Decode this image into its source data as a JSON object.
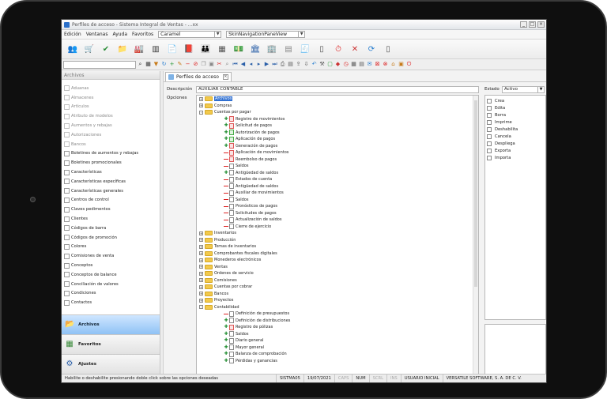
{
  "window": {
    "title": "Perfiles de acceso - Sistema Integral de Ventas - ...xx"
  },
  "menu": {
    "items": [
      "Edición",
      "Ventanas",
      "Ayuda",
      "Favoritos"
    ],
    "theme_combo": "Caramel",
    "view_combo": "SkinNavigationPaneView"
  },
  "toolbar1": {
    "icons": [
      "users-icon",
      "cart-icon",
      "check-icon",
      "folder-icon",
      "factory-icon",
      "barcode-icon",
      "document-icon",
      "book-icon",
      "people-icon",
      "calculator-icon",
      "money-icon",
      "bank-icon",
      "building-icon",
      "calendar-icon",
      "receipt-icon",
      "phone-icon",
      "clock-icon",
      "tools-icon",
      "sync-icon",
      "mobile-icon"
    ]
  },
  "sidebar": {
    "header": "Archivos",
    "items": [
      {
        "label": "Aduanas",
        "enabled": false
      },
      {
        "label": "Almacenes",
        "enabled": false
      },
      {
        "label": "Artículos",
        "enabled": false
      },
      {
        "label": "Atributo de modelos",
        "enabled": false
      },
      {
        "label": "Aumentos y rebajas",
        "enabled": false
      },
      {
        "label": "Autorizaciones",
        "enabled": false
      },
      {
        "label": "Bancos",
        "enabled": false
      },
      {
        "label": "Boletines de aumentos y rebajas",
        "enabled": true
      },
      {
        "label": "Boletines promocionales",
        "enabled": true
      },
      {
        "label": "Características",
        "enabled": true
      },
      {
        "label": "Características específicas",
        "enabled": true
      },
      {
        "label": "Características generales",
        "enabled": true
      },
      {
        "label": "Centros de control",
        "enabled": true
      },
      {
        "label": "Claves pedimentos",
        "enabled": true
      },
      {
        "label": "Clientes",
        "enabled": true
      },
      {
        "label": "Códigos de barra",
        "enabled": true
      },
      {
        "label": "Códigos de promoción",
        "enabled": true
      },
      {
        "label": "Colores",
        "enabled": true
      },
      {
        "label": "Comisiones de venta",
        "enabled": true
      },
      {
        "label": "Conceptos",
        "enabled": true
      },
      {
        "label": "Conceptos de balance",
        "enabled": true
      },
      {
        "label": "Conciliación de valores",
        "enabled": true
      },
      {
        "label": "Condiciones",
        "enabled": true
      },
      {
        "label": "Contactos",
        "enabled": true
      }
    ],
    "footer": [
      {
        "label": "Archivos",
        "icon": "folder-open-icon",
        "active": true
      },
      {
        "label": "Favoritos",
        "icon": "favorites-icon",
        "active": false
      },
      {
        "label": "Ajustes",
        "icon": "settings-icon",
        "active": false
      }
    ]
  },
  "tab": {
    "label": "Perfiles de acceso"
  },
  "form": {
    "descripcion_label": "Descripción",
    "descripcion_value": "AUXILIAR CONTABLE",
    "opciones_label": "Opciones",
    "estado_label": "Estado",
    "estado_value": "Activo"
  },
  "tree": [
    {
      "label": "Archivos",
      "level": 0,
      "type": "folder",
      "expander": "+",
      "selected": true
    },
    {
      "label": "Compras",
      "level": 0,
      "type": "folder",
      "expander": "+"
    },
    {
      "label": "Cuentas por pagar",
      "level": 0,
      "type": "folder",
      "expander": "-"
    },
    {
      "label": "Registro de movimientos",
      "level": 1,
      "type": "doc-red",
      "mark": "plus"
    },
    {
      "label": "Solicitud de pagos",
      "level": 1,
      "type": "doc-red",
      "mark": "plus"
    },
    {
      "label": "Autorización de pagos",
      "level": 1,
      "type": "doc-green",
      "mark": "plus"
    },
    {
      "label": "Aplicación de pagos",
      "level": 1,
      "type": "doc-green",
      "mark": "plus"
    },
    {
      "label": "Generación de pagos",
      "level": 1,
      "type": "doc-red",
      "mark": "plus"
    },
    {
      "label": "Aplicación de movimientos",
      "level": 1,
      "type": "doc-red",
      "mark": "dash"
    },
    {
      "label": "Reembolso de pagos",
      "level": 1,
      "type": "doc-red",
      "mark": "dash"
    },
    {
      "label": "Saldos",
      "level": 1,
      "type": "doc",
      "mark": "dash"
    },
    {
      "label": "Antigüedad de saldos",
      "level": 1,
      "type": "doc",
      "mark": "plus"
    },
    {
      "label": "Estados de cuenta",
      "level": 1,
      "type": "doc",
      "mark": "dash"
    },
    {
      "label": "Antigüedad de saldos",
      "level": 1,
      "type": "doc",
      "mark": "dash"
    },
    {
      "label": "Auxiliar de movimientos",
      "level": 1,
      "type": "doc",
      "mark": "dash"
    },
    {
      "label": "Saldos",
      "level": 1,
      "type": "doc",
      "mark": "dash"
    },
    {
      "label": "Pronósticos de pagos",
      "level": 1,
      "type": "doc",
      "mark": "dash"
    },
    {
      "label": "Solicitudes de pagos",
      "level": 1,
      "type": "doc",
      "mark": "dash"
    },
    {
      "label": "Actualización de saldos",
      "level": 1,
      "type": "doc",
      "mark": "dash"
    },
    {
      "label": "Cierre de ejercicio",
      "level": 1,
      "type": "doc",
      "mark": "dash"
    },
    {
      "label": "Inventarios",
      "level": 0,
      "type": "folder",
      "expander": "+"
    },
    {
      "label": "Producción",
      "level": 0,
      "type": "folder",
      "expander": "+"
    },
    {
      "label": "Tomas de inventarios",
      "level": 0,
      "type": "folder",
      "expander": "+"
    },
    {
      "label": "Comprobantes fiscales digitales",
      "level": 0,
      "type": "folder",
      "expander": "+"
    },
    {
      "label": "Monederos electrónicos",
      "level": 0,
      "type": "folder",
      "expander": "+"
    },
    {
      "label": "Ventas",
      "level": 0,
      "type": "folder",
      "expander": "+"
    },
    {
      "label": "Ordenes de servicio",
      "level": 0,
      "type": "folder",
      "expander": "+"
    },
    {
      "label": "Comisiones",
      "level": 0,
      "type": "folder",
      "expander": "+"
    },
    {
      "label": "Cuentas por cobrar",
      "level": 0,
      "type": "folder",
      "expander": "+"
    },
    {
      "label": "Bancos",
      "level": 0,
      "type": "folder",
      "expander": "+"
    },
    {
      "label": "Proyectos",
      "level": 0,
      "type": "folder",
      "expander": "+"
    },
    {
      "label": "Contabilidad",
      "level": 0,
      "type": "folder",
      "expander": "-"
    },
    {
      "label": "Definición de presupuestos",
      "level": 1,
      "type": "doc",
      "mark": "dash"
    },
    {
      "label": "Definición de distribuciones",
      "level": 1,
      "type": "doc",
      "mark": "plus"
    },
    {
      "label": "Registro de pólizas",
      "level": 1,
      "type": "doc-red",
      "mark": "plus"
    },
    {
      "label": "Saldos",
      "level": 1,
      "type": "doc",
      "mark": "plus"
    },
    {
      "label": "Diario general",
      "level": 1,
      "type": "doc",
      "mark": "plus"
    },
    {
      "label": "Mayor general",
      "level": 1,
      "type": "doc",
      "mark": "plus"
    },
    {
      "label": "Balanza de comprobación",
      "level": 1,
      "type": "doc",
      "mark": "plus"
    },
    {
      "label": "Pérdidas y ganancias",
      "level": 1,
      "type": "doc",
      "mark": "plus"
    }
  ],
  "permissions": [
    "Crea",
    "Edita",
    "Borra",
    "Imprime",
    "Deshabilita",
    "Cancela",
    "Despliega",
    "Exporta",
    "Importa"
  ],
  "status": {
    "hint": "Habilite o deshabilite presionando doble click sobre las opciones deseadas",
    "user": "SISTMA05",
    "date": "19/07/2021",
    "caps": "CAPS",
    "num": "NUM",
    "scrl": "SCRL",
    "ins": "INS",
    "session": "USUARIO INICIAL",
    "company": "VERSATILE SOFTWARE, S. A. DE C. V."
  }
}
